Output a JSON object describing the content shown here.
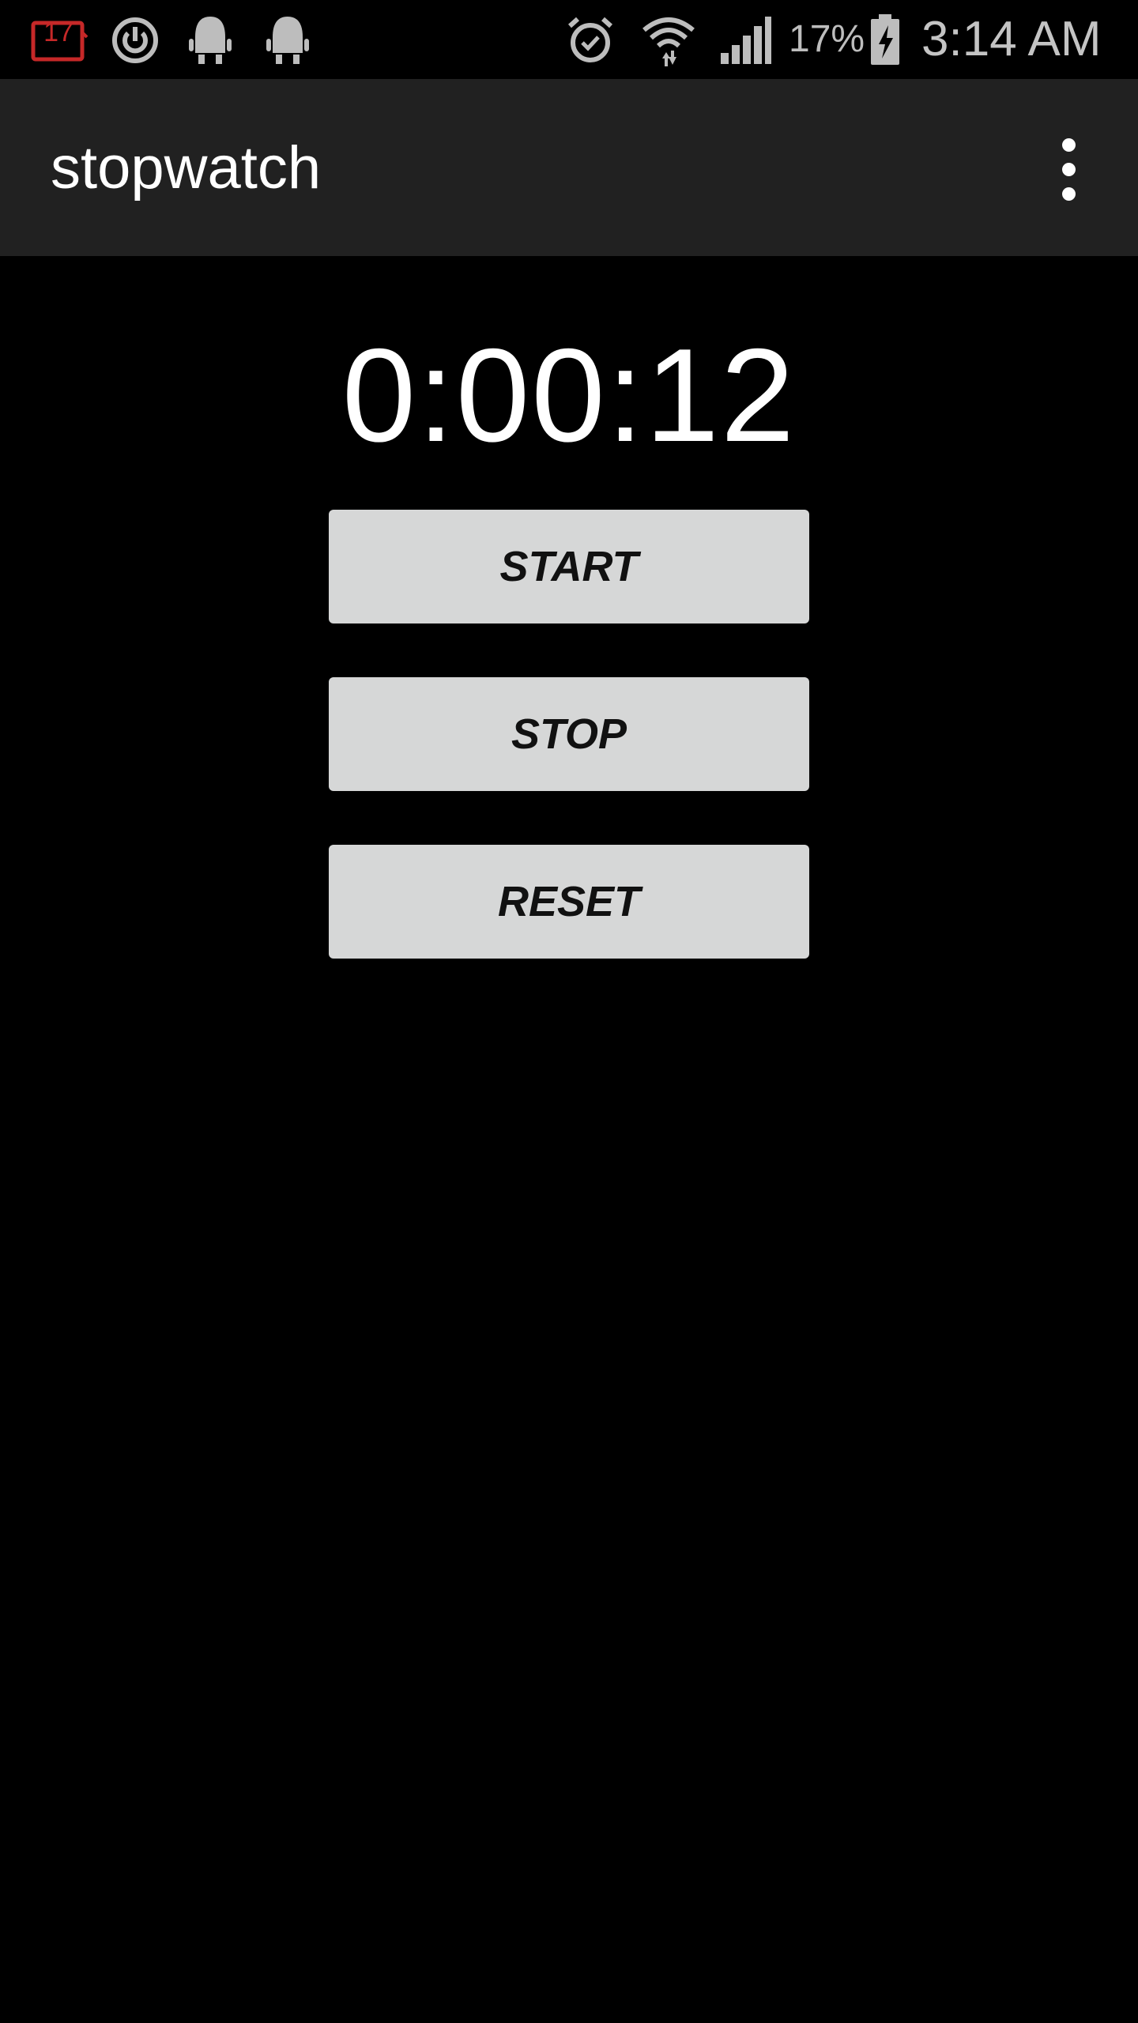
{
  "status_bar": {
    "notification_icons": [
      "calendar-icon",
      "sync-icon",
      "android-icon",
      "android-icon"
    ],
    "calendar_day": "17",
    "system_icons": [
      "alarm-icon",
      "wifi-icon",
      "signal-icon",
      "battery-charging-icon"
    ],
    "battery_percent": "17%",
    "time": "3:14 AM"
  },
  "app_bar": {
    "title": "stopwatch",
    "menu_icon": "more-vert-icon"
  },
  "timer": {
    "display": "0:00:12"
  },
  "buttons": {
    "start_label": "START",
    "stop_label": "STOP",
    "reset_label": "RESET"
  },
  "colors": {
    "background": "#000000",
    "app_bar": "#212121",
    "button": "#d6d7d7",
    "calendar_icon": "#b71c1c",
    "status_icons": "#bdbdbd"
  }
}
